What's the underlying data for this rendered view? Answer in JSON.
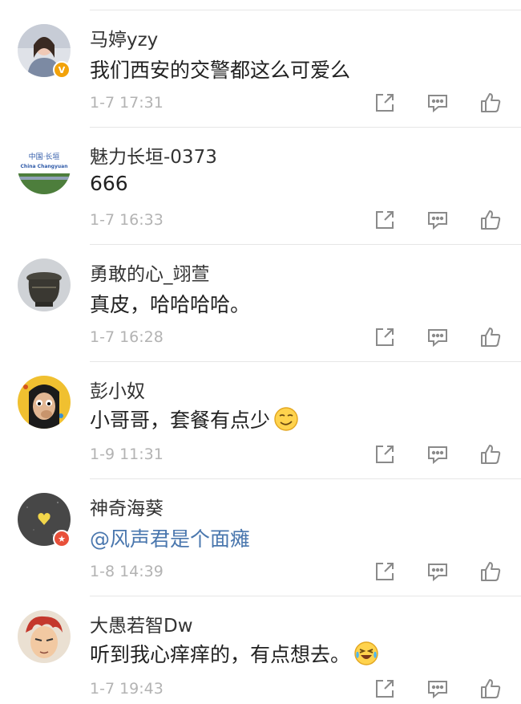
{
  "comments": [
    {
      "username": "马婷yzy",
      "text": "我们西安的交警都这么可爱么",
      "time": "1-7 17:31",
      "badge": "V",
      "badge_color": "#f2a20a",
      "avatar_colors": [
        "#d9dde4",
        "#8a96aa",
        "#f2c8b6"
      ]
    },
    {
      "username": "魅力长垣-0373",
      "text": "666",
      "time": "1-7 16:33",
      "avatar_text": "中国·长垣",
      "avatar_subtext": "China Changyuan",
      "avatar_colors": [
        "#ffffff",
        "#2f5aa8",
        "#4a7d3c"
      ]
    },
    {
      "username": "勇敢的心_翊萱",
      "text": "真皮，哈哈哈哈。",
      "time": "1-7 16:28",
      "avatar_colors": [
        "#c8ccd2",
        "#3b3a34",
        "#6e6a5c"
      ]
    },
    {
      "username": "彭小奴",
      "text": "小哥哥，套餐有点少",
      "time": "1-9 11:31",
      "emoji": "smirk-emoji",
      "avatar_colors": [
        "#f3c233",
        "#1b1b1b",
        "#d9b08a"
      ]
    },
    {
      "username": "神奇海葵",
      "text": "@风声君是个面瘫",
      "time": "1-8 14:39",
      "mention": true,
      "badge": "★",
      "badge_color": "#e8503a",
      "avatar_colors": [
        "#4b4b4b",
        "#2b2b2b",
        "#f1d84a"
      ]
    },
    {
      "username": "大愚若智Dw",
      "text": "听到我心痒痒的，有点想去。",
      "time": "1-7 19:43",
      "emoji": "laugh-cry-emoji",
      "avatar_colors": [
        "#e9dfd2",
        "#c4382c",
        "#f0c9a2"
      ]
    }
  ],
  "icons": {
    "share": "share-icon",
    "reply": "comment-icon",
    "like": "thumbs-up-icon"
  },
  "colors": {
    "username": "#333333",
    "text": "#222222",
    "mention": "#4a77ae",
    "time": "#b3b3b3",
    "icon": "#8a8a8a"
  }
}
